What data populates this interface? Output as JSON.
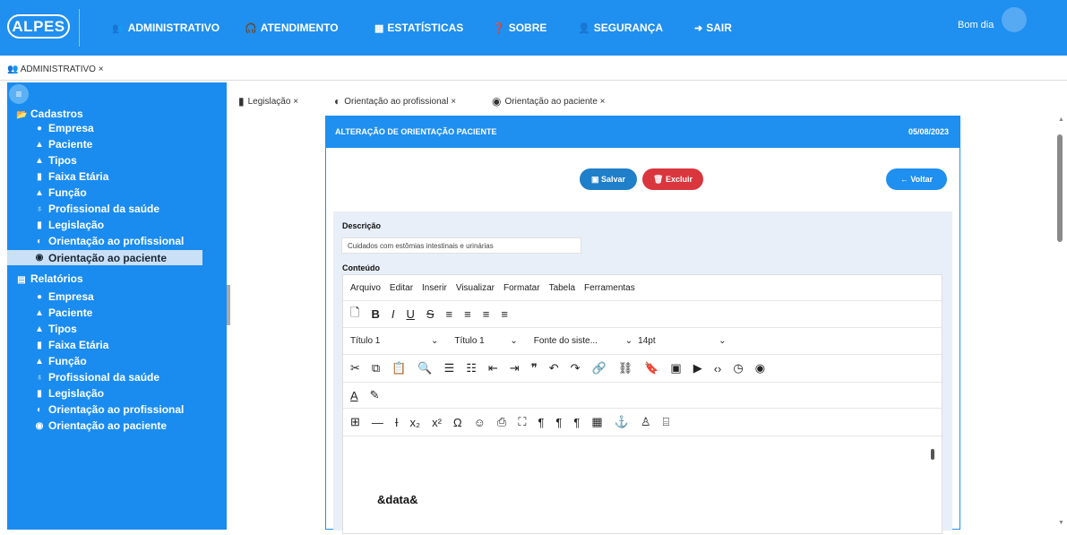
{
  "topbar": {
    "logo": "ALPES",
    "nav": [
      "ADMINISTRATIVO",
      "ATENDIMENTO",
      "ESTATÍSTICAS",
      "SOBRE",
      "SEGURANÇA",
      "SAIR"
    ],
    "greeting": "Bom dia"
  },
  "module_tab": "ADMINISTRATIVO ×",
  "sidebar": {
    "cadastros": "Cadastros",
    "cadastros_items": [
      "Empresa",
      "Paciente",
      "Tipos",
      "Faixa Etária",
      "Função",
      "Profissional da saúde",
      "Legislação",
      "Orientação ao profissional",
      "Orientação ao paciente"
    ],
    "relatorios": "Relatórios",
    "relatorios_items": [
      "Empresa",
      "Paciente",
      "Tipos",
      "Faixa Etária",
      "Função",
      "Profissional da saúde",
      "Legislação",
      "Orientação ao profissional",
      "Orientação ao paciente"
    ]
  },
  "tabs": [
    "Legislação ×",
    "Orientação ao profissional ×",
    "Orientação ao paciente ×"
  ],
  "panel": {
    "title": "ALTERAÇÃO DE ORIENTAÇÃO PACIENTE",
    "date": "05/08/2023",
    "save": "Salvar",
    "delete": "Excluir",
    "back": "Voltar",
    "desc_label": "Descrição",
    "desc_value": "Cuidados com estômias intestinais e urinárias",
    "content_label": "Conteúdo",
    "menu": [
      "Arquivo",
      "Editar",
      "Inserir",
      "Visualizar",
      "Formatar",
      "Tabela",
      "Ferramentas"
    ],
    "styles": [
      "Título 1",
      "Título 1",
      "Fonte do siste...",
      "14pt"
    ],
    "content_text": "&data&"
  },
  "colors": {
    "primary": "#1f8ff0",
    "danger": "#d9363e",
    "sidebar_active": "#c9e0f7"
  }
}
